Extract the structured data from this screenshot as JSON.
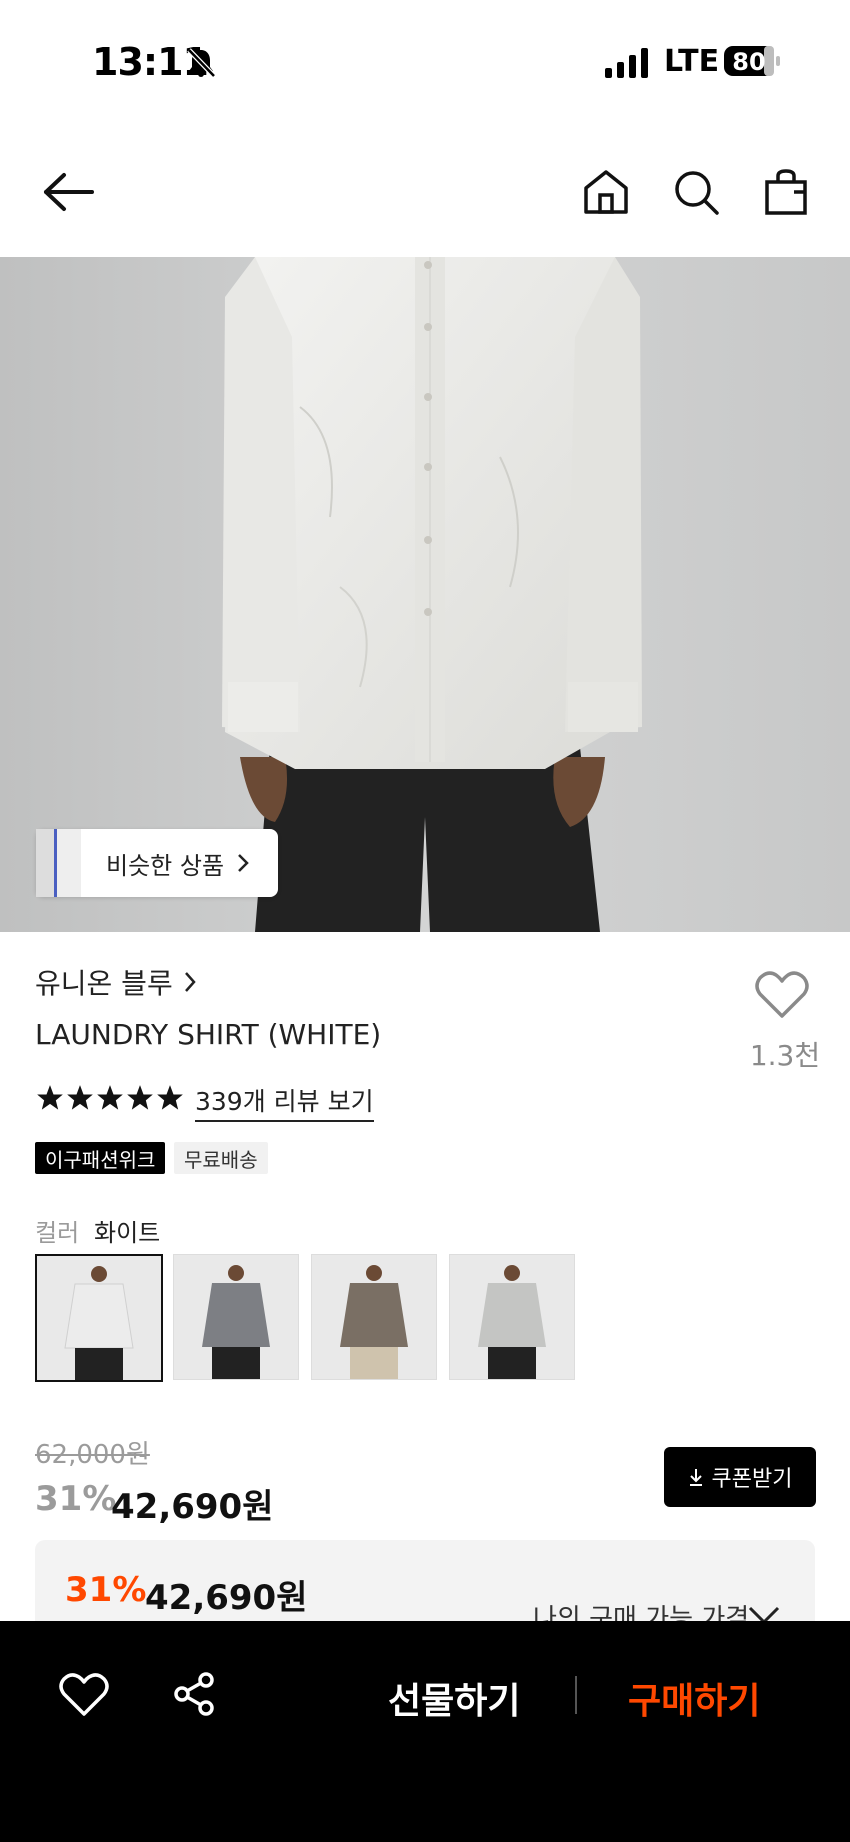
{
  "status_bar": {
    "time": "13:11",
    "network": "LTE",
    "battery": "80"
  },
  "nav": {
    "icons": [
      "back-arrow-icon",
      "home-icon",
      "search-icon",
      "shopping-bag-icon"
    ]
  },
  "similar_button": {
    "label": "비슷한 상품"
  },
  "product": {
    "brand": "유니온 블루",
    "name": "LAUNDRY SHIRT (WHITE)",
    "rating_stars": 5,
    "review_link": "339개 리뷰 보기",
    "likes": "1.3천",
    "badges": [
      "이구패션위크",
      "무료배송"
    ]
  },
  "color": {
    "label": "컬러",
    "selected": "화이트",
    "swatches": [
      {
        "shirt": "#ececec"
      },
      {
        "shirt": "#7d7f84"
      },
      {
        "shirt": "#7a6f64"
      },
      {
        "shirt": "#c4c5c3"
      }
    ]
  },
  "price": {
    "original": "62,000원",
    "discount_rate": "31%",
    "sale": "42,690원",
    "coupon_label": "쿠폰받기"
  },
  "price_box": {
    "discount_rate": "31%",
    "sale": "42,690원",
    "my_price_label": "나의 구매 가능 가격"
  },
  "bottom_bar": {
    "gift_label": "선물하기",
    "buy_label": "구매하기"
  },
  "colors": {
    "accent": "#ff4800",
    "black": "#000000"
  }
}
